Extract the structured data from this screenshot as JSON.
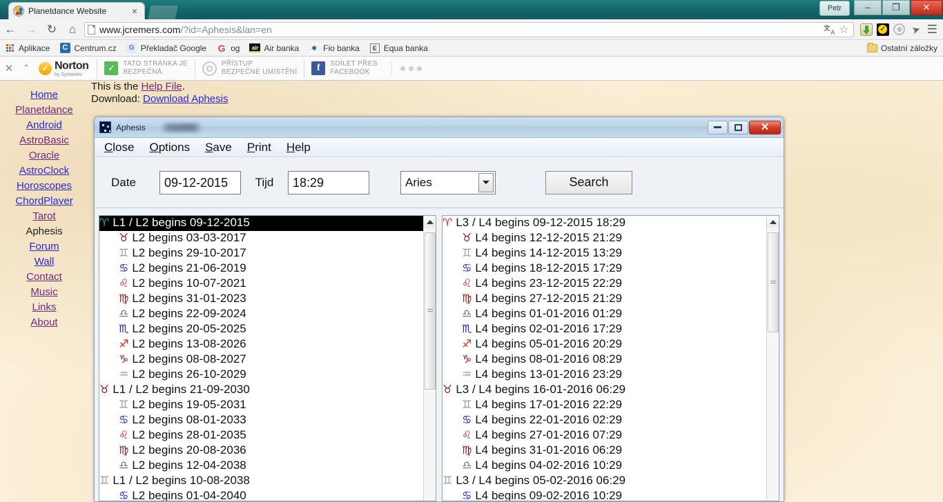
{
  "browser": {
    "tab": {
      "title": "Planetdance Website",
      "favicon": "planetdance-favicon",
      "close": "×"
    },
    "nav": {
      "back": "←",
      "forward": "→",
      "reload": "↻",
      "home": "⌂"
    },
    "address": {
      "url_main": "www.jcremers.com",
      "url_rest": "/?id=Aphesis&lan=en"
    },
    "omni_icons": {
      "translate_a": "文",
      "translate_b": "A",
      "bookmark_star": "☆"
    },
    "extensions": [
      "download-icon",
      "norton-icon",
      "privacy-icon",
      "send-icon"
    ],
    "menu": "☰",
    "window": {
      "user": "Petr",
      "minimize": "–",
      "restore": "❐",
      "close": "✕"
    },
    "bookmarks": [
      {
        "label": "Aplikace",
        "icon": "apps-grid-icon"
      },
      {
        "label": "Centrum.cz",
        "icon": "centrum-icon",
        "glyph": "C"
      },
      {
        "label": "Překladač Google",
        "icon": "google-translate-icon",
        "glyph": "G"
      },
      {
        "label": "og",
        "icon": "google-icon",
        "glyph": "G"
      },
      {
        "label": "Air banka",
        "icon": "airbank-icon",
        "glyph": "air"
      },
      {
        "label": "Fio banka",
        "icon": "fio-icon",
        "glyph": "✶"
      },
      {
        "label": "Equa banka",
        "icon": "equa-icon",
        "glyph": "E"
      }
    ],
    "other_bookmarks": {
      "label": "Ostatní záložky",
      "icon": "folder-icon"
    }
  },
  "norton_toolbar": {
    "close": "✕",
    "collapse": "⌃",
    "brand": "Norton",
    "brand_sub": "by Symantec",
    "segments": [
      {
        "line1": "TATO STRÁNKA JE",
        "line2": "BEZPEČNÁ",
        "icon": "green-check-icon"
      },
      {
        "line1": "PŘÍSTUP",
        "line2": "BEZPEČNÉ UMÍSTĚNÍ",
        "icon": "spiral-icon"
      },
      {
        "line1": "SDÍLET PŘES",
        "line2": "FACEBOOK",
        "icon": "facebook-icon",
        "glyph": "f"
      }
    ],
    "more": "more-dots-icon"
  },
  "sidebar": {
    "items": [
      {
        "label": "Home",
        "state": "link"
      },
      {
        "label": "Planetdance",
        "state": "visited"
      },
      {
        "label": "Android",
        "state": "link"
      },
      {
        "label": "AstroBasic",
        "state": "visited"
      },
      {
        "label": "Oracle",
        "state": "visited"
      },
      {
        "label": "AstroClock",
        "state": "link"
      },
      {
        "label": "Horoscopes",
        "state": "link"
      },
      {
        "label": "ChordPlayer",
        "state": "link"
      },
      {
        "label": "Tarot",
        "state": "visited"
      },
      {
        "label": "Aphesis",
        "state": "current"
      },
      {
        "label": "Forum",
        "state": "link"
      },
      {
        "label": "Wall",
        "state": "link"
      },
      {
        "label": "Contact",
        "state": "visited"
      },
      {
        "label": "Music",
        "state": "visited"
      },
      {
        "label": "Links",
        "state": "visited"
      },
      {
        "label": "About",
        "state": "visited"
      }
    ]
  },
  "content": {
    "line1_pre": "This is the ",
    "line1_link": "Help File",
    "line1_post": ".",
    "line2_pre": "Download: ",
    "line2_link": "Download Aphesis"
  },
  "aphesis": {
    "title": "Aphesis",
    "icon": "starfield-icon",
    "menu": [
      {
        "label": "Close",
        "accel": "C"
      },
      {
        "label": "Options",
        "accel": "O"
      },
      {
        "label": "Save",
        "accel": "S"
      },
      {
        "label": "Print",
        "accel": "P"
      },
      {
        "label": "Help",
        "accel": "H"
      }
    ],
    "form": {
      "date_label": "Date",
      "date_value": "09-12-2015",
      "time_label": "Tijd",
      "time_value": "18:29",
      "sign_value": "Aries",
      "search_label": "Search"
    },
    "left_list": [
      {
        "sign": "Aries",
        "glyph": "♈",
        "color": "#1fb0a0",
        "text": "L1 / L2 begins 09-12-2015",
        "major": true,
        "selected": true
      },
      {
        "sign": "Taurus",
        "glyph": "♉",
        "color": "#8c1a1a",
        "text": "L2 begins 03-03-2017",
        "major": false,
        "selected": false
      },
      {
        "sign": "Gemini",
        "glyph": "♊",
        "color": "#9a9a9a",
        "text": "L2 begins 29-10-2017",
        "major": false,
        "selected": false
      },
      {
        "sign": "Cancer",
        "glyph": "♋",
        "color": "#1a1ad0",
        "text": "L2 begins 21-06-2019",
        "major": false,
        "selected": false
      },
      {
        "sign": "Leo",
        "glyph": "♌",
        "color": "#e02020",
        "text": "L2 begins 10-07-2021",
        "major": false,
        "selected": false
      },
      {
        "sign": "Virgo",
        "glyph": "♍",
        "color": "#8c1a1a",
        "text": "L2 begins 31-01-2023",
        "major": false,
        "selected": false
      },
      {
        "sign": "Libra",
        "glyph": "♎",
        "color": "#6a6a6a",
        "text": "L2 begins 22-09-2024",
        "major": false,
        "selected": false
      },
      {
        "sign": "Scorpio",
        "glyph": "♏",
        "color": "#1a1ad0",
        "text": "L2 begins 20-05-2025",
        "major": false,
        "selected": false
      },
      {
        "sign": "Sagittarius",
        "glyph": "♐",
        "color": "#e02020",
        "text": "L2 begins 13-08-2026",
        "major": false,
        "selected": false
      },
      {
        "sign": "Capricorn",
        "glyph": "♑",
        "color": "#8c1a1a",
        "text": "L2 begins 08-08-2027",
        "major": false,
        "selected": false
      },
      {
        "sign": "Aquarius",
        "glyph": "♒",
        "color": "#9a9a9a",
        "text": "L2 begins 26-10-2029",
        "major": false,
        "selected": false
      },
      {
        "sign": "Taurus",
        "glyph": "♉",
        "color": "#8c1a1a",
        "text": "L1 / L2 begins 21-09-2030",
        "major": true,
        "selected": false
      },
      {
        "sign": "Gemini",
        "glyph": "♊",
        "color": "#9a9a9a",
        "text": "L2 begins 19-05-2031",
        "major": false,
        "selected": false
      },
      {
        "sign": "Cancer",
        "glyph": "♋",
        "color": "#1a1ad0",
        "text": "L2 begins 08-01-2033",
        "major": false,
        "selected": false
      },
      {
        "sign": "Leo",
        "glyph": "♌",
        "color": "#e02020",
        "text": "L2 begins 28-01-2035",
        "major": false,
        "selected": false
      },
      {
        "sign": "Virgo",
        "glyph": "♍",
        "color": "#8c1a1a",
        "text": "L2 begins 20-08-2036",
        "major": false,
        "selected": false
      },
      {
        "sign": "Libra",
        "glyph": "♎",
        "color": "#6a6a6a",
        "text": "L2 begins 12-04-2038",
        "major": false,
        "selected": false
      },
      {
        "sign": "Gemini",
        "glyph": "♊",
        "color": "#9a9a9a",
        "text": "L1 / L2 begins 10-08-2038",
        "major": true,
        "selected": false
      },
      {
        "sign": "Cancer",
        "glyph": "♋",
        "color": "#1a1ad0",
        "text": "L2 begins 01-04-2040",
        "major": false,
        "selected": false
      }
    ],
    "right_list": [
      {
        "sign": "Aries",
        "glyph": "♈",
        "color": "#e02020",
        "text": "L3 / L4 begins 09-12-2015 18:29",
        "major": true
      },
      {
        "sign": "Taurus",
        "glyph": "♉",
        "color": "#8c1a1a",
        "text": "L4 begins 12-12-2015 21:29",
        "major": false
      },
      {
        "sign": "Gemini",
        "glyph": "♊",
        "color": "#9a9a9a",
        "text": "L4 begins 14-12-2015 13:29",
        "major": false
      },
      {
        "sign": "Cancer",
        "glyph": "♋",
        "color": "#1a1ad0",
        "text": "L4 begins 18-12-2015 17:29",
        "major": false
      },
      {
        "sign": "Leo",
        "glyph": "♌",
        "color": "#e02020",
        "text": "L4 begins 23-12-2015 22:29",
        "major": false
      },
      {
        "sign": "Virgo",
        "glyph": "♍",
        "color": "#8c1a1a",
        "text": "L4 begins 27-12-2015 21:29",
        "major": false
      },
      {
        "sign": "Libra",
        "glyph": "♎",
        "color": "#6a6a6a",
        "text": "L4 begins 01-01-2016 01:29",
        "major": false
      },
      {
        "sign": "Scorpio",
        "glyph": "♏",
        "color": "#1a1ad0",
        "text": "L4 begins 02-01-2016 17:29",
        "major": false
      },
      {
        "sign": "Sagittarius",
        "glyph": "♐",
        "color": "#e02020",
        "text": "L4 begins 05-01-2016 20:29",
        "major": false
      },
      {
        "sign": "Capricorn",
        "glyph": "♑",
        "color": "#8c1a1a",
        "text": "L4 begins 08-01-2016 08:29",
        "major": false
      },
      {
        "sign": "Aquarius",
        "glyph": "♒",
        "color": "#9a9a9a",
        "text": "L4 begins 13-01-2016 23:29",
        "major": false
      },
      {
        "sign": "Taurus",
        "glyph": "♉",
        "color": "#8c1a1a",
        "text": "L3 / L4 begins 16-01-2016 06:29",
        "major": true
      },
      {
        "sign": "Gemini",
        "glyph": "♊",
        "color": "#9a9a9a",
        "text": "L4 begins 17-01-2016 22:29",
        "major": false
      },
      {
        "sign": "Cancer",
        "glyph": "♋",
        "color": "#1a1ad0",
        "text": "L4 begins 22-01-2016 02:29",
        "major": false
      },
      {
        "sign": "Leo",
        "glyph": "♌",
        "color": "#e02020",
        "text": "L4 begins 27-01-2016 07:29",
        "major": false
      },
      {
        "sign": "Virgo",
        "glyph": "♍",
        "color": "#8c1a1a",
        "text": "L4 begins 31-01-2016 06:29",
        "major": false
      },
      {
        "sign": "Libra",
        "glyph": "♎",
        "color": "#6a6a6a",
        "text": "L4 begins 04-02-2016 10:29",
        "major": false
      },
      {
        "sign": "Gemini",
        "glyph": "♊",
        "color": "#9a9a9a",
        "text": "L3 / L4 begins 05-02-2016 06:29",
        "major": true
      },
      {
        "sign": "Cancer",
        "glyph": "♋",
        "color": "#1a1ad0",
        "text": "L4 begins 09-02-2016 10:29",
        "major": false
      }
    ],
    "scrollbars": {
      "left": {
        "up": "▲",
        "down": "▼",
        "thumb_top_pct": 7,
        "thumb_height_pct": 55
      },
      "right": {
        "up": "▲",
        "down": "▼",
        "thumb_top_pct": 7,
        "thumb_height_pct": 35
      }
    }
  }
}
